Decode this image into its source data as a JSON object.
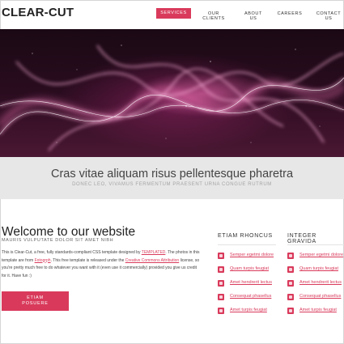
{
  "brand": {
    "logo": "CLEAR-CUT"
  },
  "nav": {
    "items": [
      {
        "label": "SERVICES",
        "active": true
      },
      {
        "label": "OUR CLIENTS",
        "active": false
      },
      {
        "label": "ABOUT US",
        "active": false
      },
      {
        "label": "CAREERS",
        "active": false
      },
      {
        "label": "CONTACT US",
        "active": false
      }
    ]
  },
  "tagline": {
    "title": "Cras vitae aliquam risus pellentesque pharetra",
    "subtitle": "DONEC LEO, VIVAMUS FERMENTUM PRAESENT URNA CONGUE RUTRUM"
  },
  "welcome": {
    "title": "Welcome to our website",
    "subtitle": "MAURIS VULPUTATE DOLOR SIT AMET NIBH",
    "body_parts": [
      "This is Clear-Cut, a free, fully standards-compliant CSS template designed by ",
      "TEMPLATED",
      ". The photos in this template are from ",
      "Fotogrph",
      ". This free template is released under the ",
      "Creative Commons Attribution",
      " license, so you're pretty much free to do whatever you want with it (even use it commercially) provided you give us credit for it. Have fun :)"
    ],
    "cta_label": "ETIAM POSUERE"
  },
  "columns": [
    {
      "title": "ETIAM RHONCUS",
      "links": [
        "Semper egetmi dolore",
        "Quam turpis feugiat",
        "Amet hendrerit lectus",
        "Consequat phasellus",
        "Amet turpis feugiat"
      ]
    },
    {
      "title": "INTEGER GRAVIDA",
      "links": [
        "Semper egetmi dolore",
        "Quam turpis feugiat",
        "Amet hendrerit lectus",
        "Consequat phasellus",
        "Amet turpis feugiat"
      ]
    }
  ],
  "colors": {
    "accent": "#d93a5b",
    "band": "#e7e7e7",
    "banner_dark": "#1a0914"
  }
}
